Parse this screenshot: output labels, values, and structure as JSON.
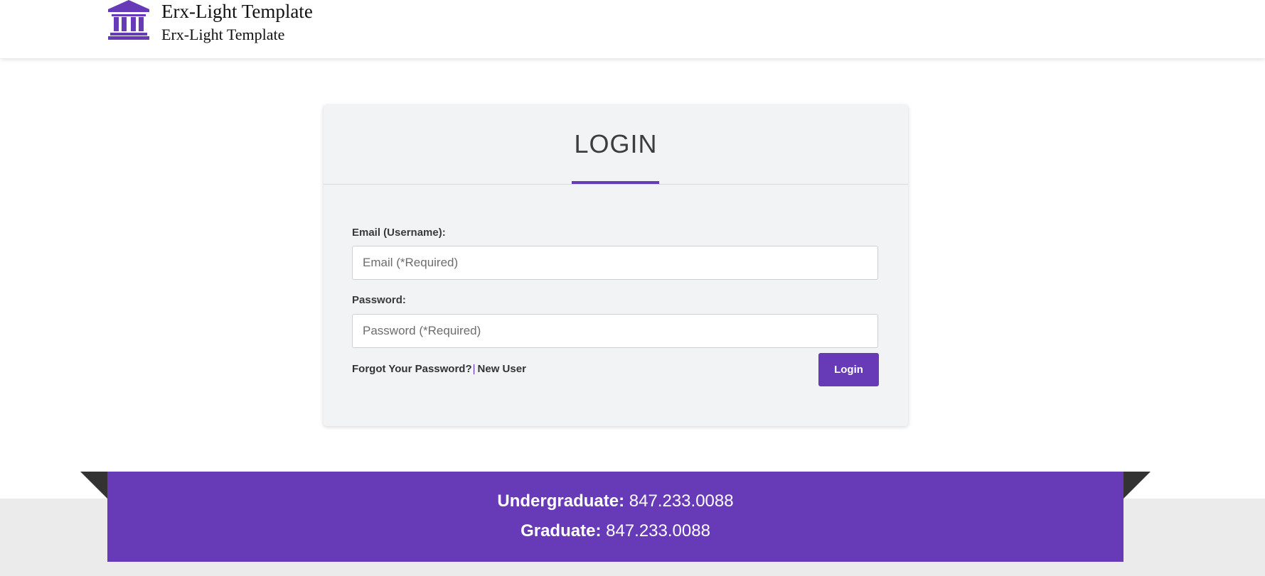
{
  "header": {
    "logo_icon": "institution-building-icon",
    "title": "Erx-Light Template",
    "subtitle": "Erx-Light Template"
  },
  "login": {
    "title": "LOGIN",
    "email_label": "Email (Username):",
    "email_placeholder": "Email (*Required)",
    "email_value": "",
    "password_label": "Password:",
    "password_placeholder": "Password (*Required)",
    "password_value": "",
    "forgot_password": "Forgot Your Password?",
    "separator": "|",
    "new_user": "New User",
    "submit_label": "Login"
  },
  "footer": {
    "undergraduate_label": "Undergraduate:",
    "undergraduate_phone": "847.233.0088",
    "graduate_label": "Graduate:",
    "graduate_phone": "847.233.0088"
  },
  "colors": {
    "accent": "#673ab7",
    "card_background": "#f2f3f5",
    "footer_background": "#ebebeb",
    "ribbon_fold": "#333333"
  }
}
